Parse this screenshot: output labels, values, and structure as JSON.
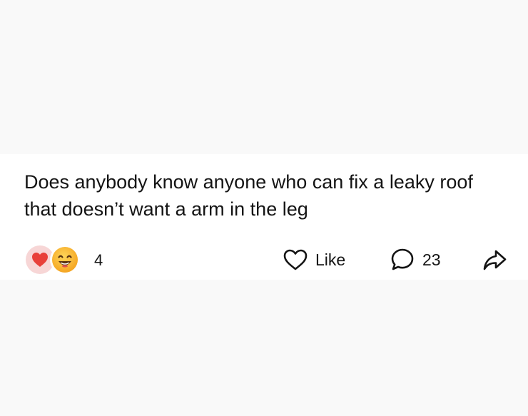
{
  "post": {
    "text": "Does anybody know anyone who can fix a leaky roof that doesn’t want a arm in the leg",
    "reactions": {
      "icons": [
        "heart-icon",
        "smile-emoji-icon"
      ],
      "count": "4"
    },
    "like_label": "Like",
    "comment_count": "23",
    "share_icon": "share-arrow-icon"
  },
  "colors": {
    "page_background": "#f9f9f9",
    "card_background": "#ffffff",
    "text": "#141414",
    "heart": "#e8403a",
    "heart_badge": "#f7d6d6",
    "smile": "#f9b93a"
  }
}
